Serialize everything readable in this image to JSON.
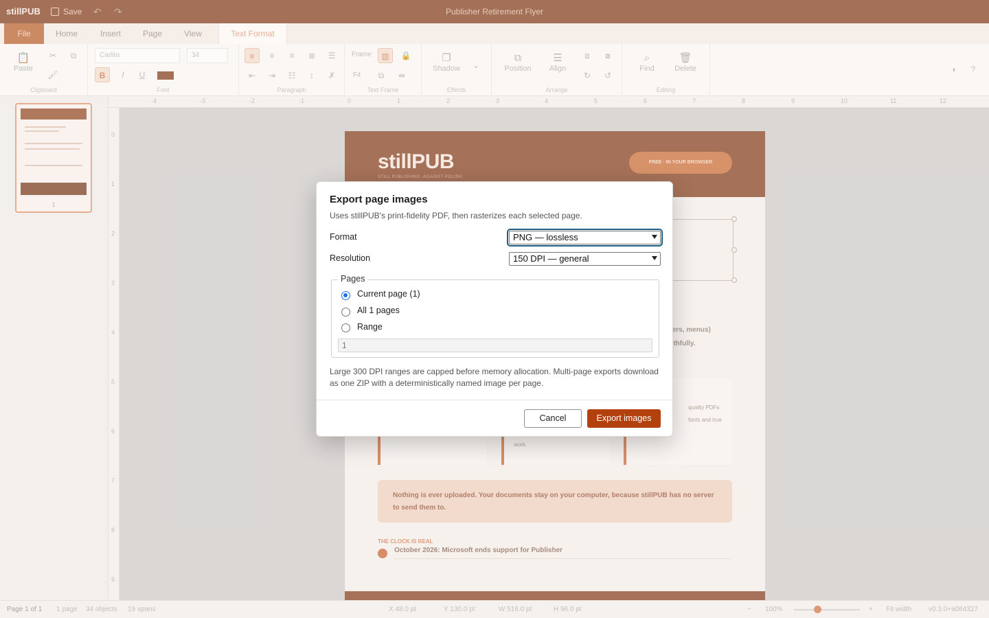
{
  "app": {
    "logo": "stillPUB",
    "save_label": "Save",
    "document_title": "Publisher Retirement Flyer"
  },
  "tabs": [
    "File",
    "Home",
    "Insert",
    "Page",
    "View",
    "Text Format"
  ],
  "ribbon": {
    "paste": "Paste",
    "font_name": "Carlito",
    "font_size": "34",
    "frame_label": "Frame",
    "fit_label": "Fit",
    "shadow": "Shadow",
    "position": "Position",
    "align": "Align",
    "find": "Find",
    "delete": "Delete",
    "groups": [
      "Clipboard",
      "Font",
      "Paragraph",
      "Text Frame",
      "Effects",
      "Arrange",
      "Editing"
    ],
    "colors": {
      "font_color": "#7a2d08"
    }
  },
  "thumbnail": {
    "page_number": "1"
  },
  "rulers": {
    "top": [
      "-4",
      "-3",
      "-2",
      "-1",
      "0",
      "1",
      "2",
      "3",
      "4",
      "5",
      "6",
      "7",
      "8",
      "9",
      "10",
      "11",
      "12"
    ],
    "left": [
      "0",
      "1",
      "2",
      "3",
      "4",
      "5",
      "6",
      "7",
      "8",
      "9"
    ]
  },
  "document": {
    "brand": "stillPUB",
    "brand_sub": "STILL PUBLISHING. AGAINST POLISH.",
    "pill": "FREE · IN YOUR BROWSER",
    "body_lines": [
      "tters, menus)",
      "aithfully."
    ],
    "card_texts": [
      "quality PDFs",
      "fonts and true",
      "work."
    ],
    "callout": "Nothing is ever uploaded. Your documents stay on your computer, because stillPUB has no server to send them to.",
    "clock_label": "THE CLOCK IS REAL",
    "clock_item": "October 2026: Microsoft ends support for Publisher"
  },
  "status": {
    "page": "Page 1 of 1",
    "pages": "1 page",
    "objects": "34 objects",
    "spans": "19 spans",
    "x": "X 48.0 pt",
    "y": "Y 130.0 pt",
    "w": "W 516.0 pt",
    "h": "H 96.0 pt",
    "zoom": "100%",
    "fit_width": "Fit width",
    "version": "v0.3.0+a064327"
  },
  "dialog": {
    "title": "Export page images",
    "subtitle": "Uses stillPUB's print-fidelity PDF, then rasterizes each selected page.",
    "format_label": "Format",
    "format_value": "PNG — lossless",
    "resolution_label": "Resolution",
    "resolution_value": "150 DPI — general",
    "pages_legend": "Pages",
    "options": [
      "Current page (1)",
      "All 1 pages",
      "Range"
    ],
    "selected_option": 0,
    "range_value": "1",
    "note": "Large 300 DPI ranges are capped before memory allocation. Multi-page exports download as one ZIP with a deterministically named image per page.",
    "cancel": "Cancel",
    "export": "Export images",
    "colors": {
      "primary": "#b2410e",
      "focus": "#1d5e86",
      "radio": "#1a73e8"
    }
  }
}
